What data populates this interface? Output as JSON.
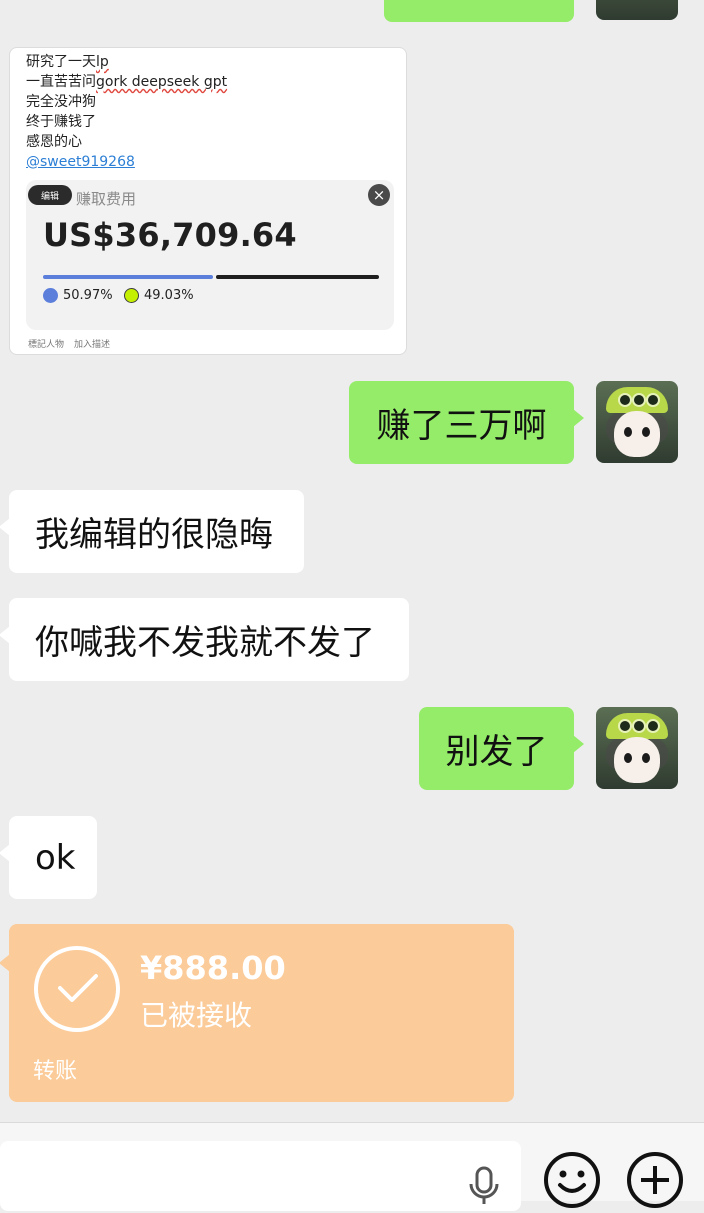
{
  "screenshot_card": {
    "lines": [
      "研究了一天",
      "一直苦苦问",
      "完全没冲狗",
      "终于赚钱了",
      "感恩的心"
    ],
    "line1_tail": "lp",
    "line2_tail": "gork deepseek gpt",
    "handle": "@sweet919268",
    "edit_tag": "编辑",
    "sub_label": "赚取费用",
    "close": "×",
    "amount": "US$36,709.64",
    "pct_a": "50.97%",
    "pct_b": "49.03%",
    "foot_a": "標記人物",
    "foot_b": "加入描述"
  },
  "messages": {
    "me_1": "赚了三万啊",
    "other_1": "我编辑的很隐晦",
    "other_2": "你喊我不发我就不发了",
    "me_2": "别发了",
    "other_3": "ok"
  },
  "transfer": {
    "amount": "¥888.00",
    "status": "已被接收",
    "kind": "转账"
  },
  "icons": [
    "avatar",
    "check-icon",
    "mic-icon",
    "emoji-icon",
    "plus-icon"
  ]
}
